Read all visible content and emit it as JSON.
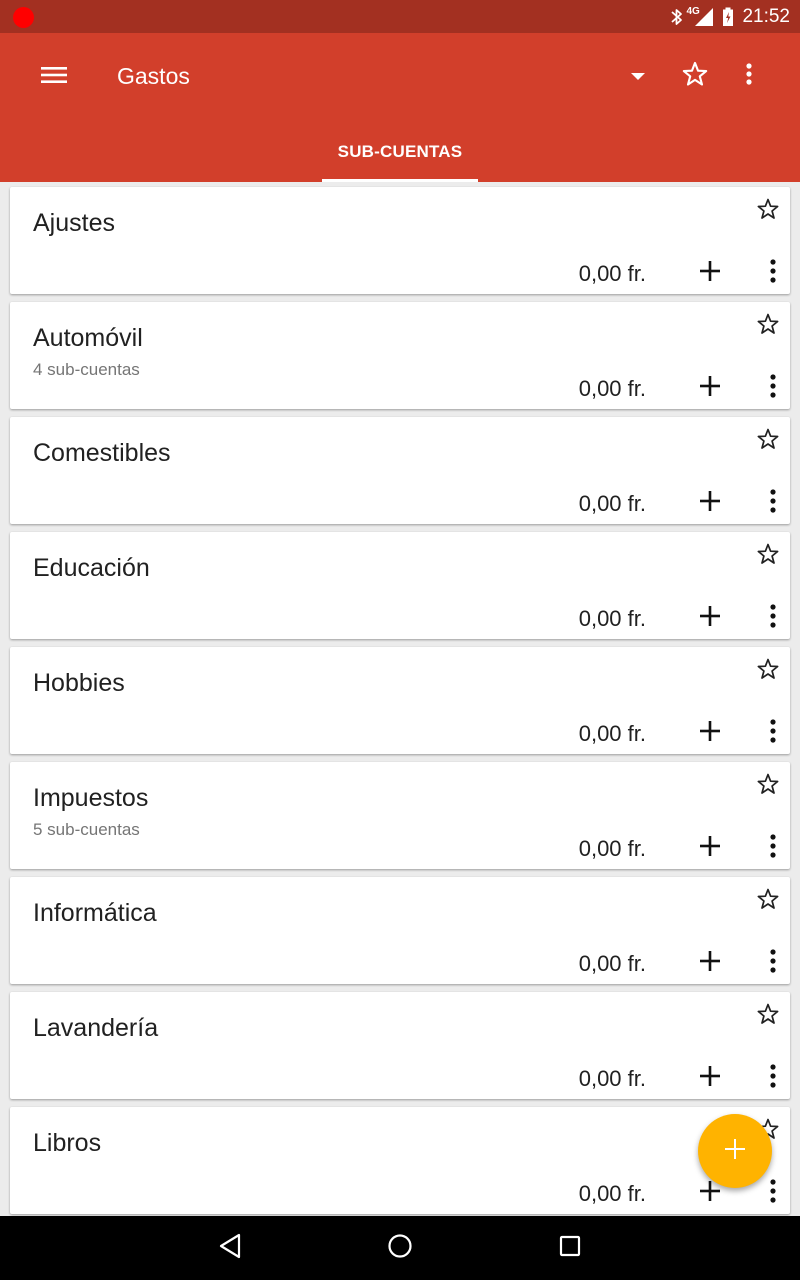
{
  "status_bar": {
    "network": "4G",
    "time": "21:52"
  },
  "app_bar": {
    "title": "Gastos",
    "tab_label": "SUB-CUENTAS"
  },
  "icons": {
    "menu": "menu-icon",
    "dropdown": "arrow-drop-down-icon",
    "favorite": "star-outline-icon",
    "more": "more-vert-icon",
    "add": "add-icon",
    "fab": "add-icon"
  },
  "colors": {
    "status_bar": "#a33021",
    "app_bar": "#d23f2b",
    "fab": "#ffb300",
    "background": "#ececec"
  },
  "accounts": [
    {
      "name": "Ajustes",
      "sub": "",
      "amount": "0,00 fr."
    },
    {
      "name": "Automóvil",
      "sub": "4 sub-cuentas",
      "amount": "0,00 fr."
    },
    {
      "name": "Comestibles",
      "sub": "",
      "amount": "0,00 fr."
    },
    {
      "name": "Educación",
      "sub": "",
      "amount": "0,00 fr."
    },
    {
      "name": "Hobbies",
      "sub": "",
      "amount": "0,00 fr."
    },
    {
      "name": "Impuestos",
      "sub": "5 sub-cuentas",
      "amount": "0,00 fr."
    },
    {
      "name": "Informática",
      "sub": "",
      "amount": "0,00 fr."
    },
    {
      "name": "Lavandería",
      "sub": "",
      "amount": "0,00 fr."
    },
    {
      "name": "Libros",
      "sub": "",
      "amount": "0,00 fr."
    }
  ]
}
